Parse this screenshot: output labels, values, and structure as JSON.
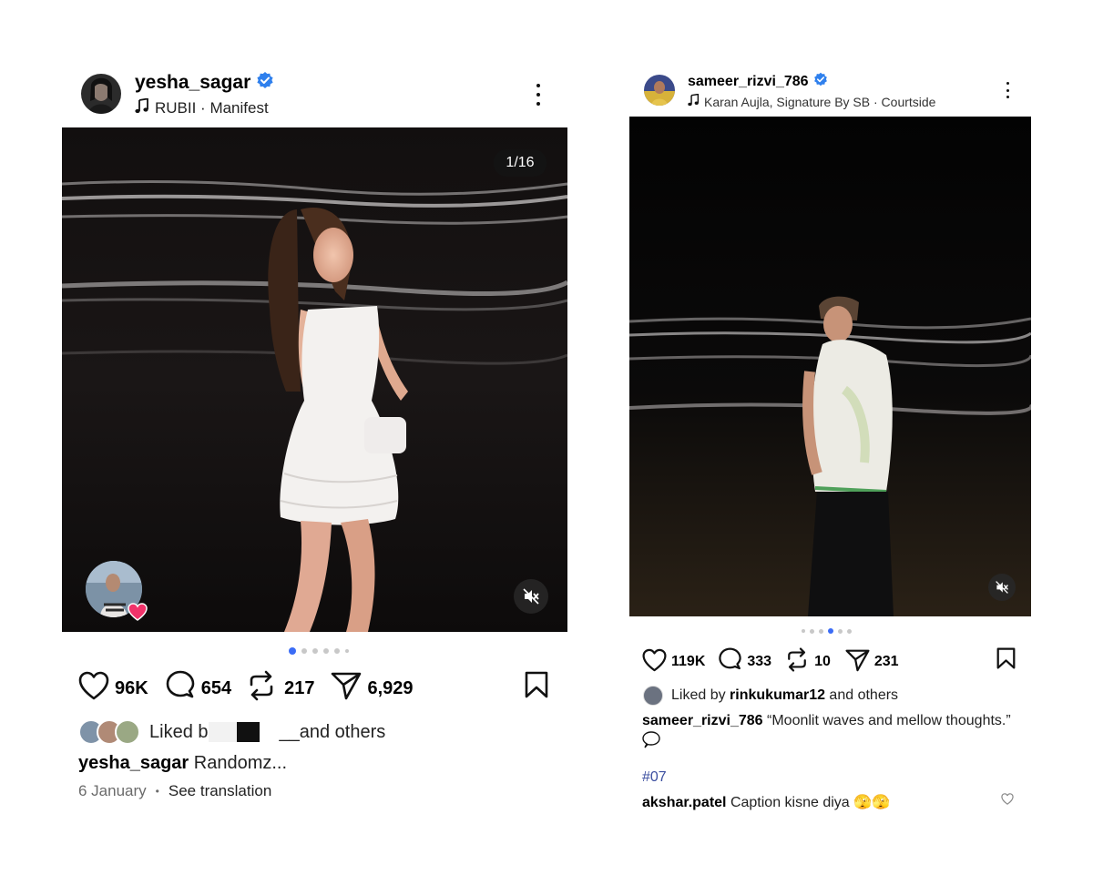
{
  "left_post": {
    "username": "yesha_sagar",
    "music": "RUBII · Manifest",
    "counter": "1/16",
    "likes": "96K",
    "comments": "654",
    "reposts": "217",
    "shares": "6,929",
    "liked_by_prefix": "Liked b",
    "liked_by_redacted": "__",
    "liked_by_suffix": " and others",
    "caption_user": "yesha_sagar",
    "caption_text": " Randomz...",
    "date": "6 January",
    "bullet": "•",
    "see_translation": "See translation",
    "carousel_dots": 6,
    "carousel_active": 0,
    "icons": [
      "more-icon",
      "music-note-icon",
      "verified-icon",
      "mute-icon",
      "heart-icon",
      "comment-icon",
      "repost-icon",
      "share-icon",
      "bookmark-icon"
    ]
  },
  "right_post": {
    "username": "sameer_rizvi_786",
    "music": "Karan Aujla, Signature By SB · Courtside",
    "likes": "119K",
    "comments": "333",
    "reposts": "10",
    "shares": "231",
    "liked_by_prefix": "Liked by ",
    "liked_by_user": "rinkukumar12",
    "liked_by_suffix": " and others",
    "caption_user": "sameer_rizvi_786",
    "caption_text": " “Moonlit waves and mellow thoughts.”",
    "hashtag": "#07",
    "comment_user": "akshar.patel",
    "comment_text": " Caption kisne diya 🫣🫣",
    "carousel_dots": 6,
    "carousel_active": 3
  },
  "colors": {
    "verified": "#2f80ed",
    "active_dot": "#3b6cf6",
    "hashtag": "#3c4fa0",
    "muted_text": "#6b6b6b",
    "heart_badge": "#f0336a"
  }
}
